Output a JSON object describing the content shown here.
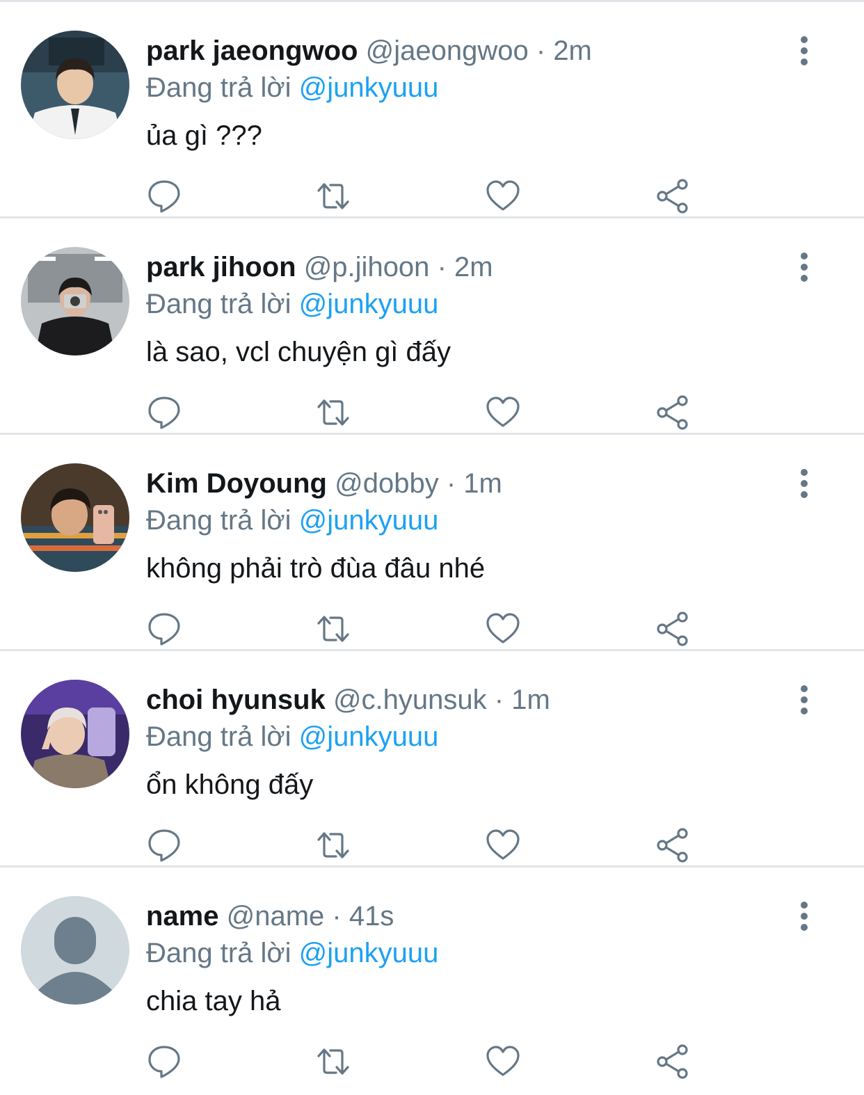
{
  "tweets": [
    {
      "display_name": "park jaeongwoo",
      "handle": "@jaeongwoo",
      "separator": "·",
      "time": "2m",
      "replying_prefix": "Đang trả lời",
      "replying_to": "@junkyuuu",
      "text": "ủa gì ???"
    },
    {
      "display_name": "park jihoon",
      "handle": "@p.jihoon",
      "separator": "·",
      "time": "2m",
      "replying_prefix": "Đang trả lời",
      "replying_to": "@junkyuuu",
      "text": "là sao, vcl chuyện gì đấy"
    },
    {
      "display_name": "Kim Doyoung",
      "handle": "@dobby",
      "separator": "·",
      "time": "1m",
      "replying_prefix": "Đang trả lời",
      "replying_to": "@junkyuuu",
      "text": "không phải trò đùa đâu nhé"
    },
    {
      "display_name": "choi hyunsuk",
      "handle": "@c.hyunsuk",
      "separator": "·",
      "time": "1m",
      "replying_prefix": "Đang trả lời",
      "replying_to": "@junkyuuu",
      "text": "ổn không đấy"
    },
    {
      "display_name": "name",
      "handle": "@name",
      "separator": "·",
      "time": "41s",
      "replying_prefix": "Đang trả lời",
      "replying_to": "@junkyuuu",
      "text": "chia tay hả"
    }
  ],
  "icons": {
    "reply": "reply-icon",
    "retweet": "retweet-icon",
    "like": "heart-icon",
    "share": "share-icon",
    "more": "more-vertical-icon"
  },
  "colors": {
    "text_primary": "#14171a",
    "text_secondary": "#657786",
    "link": "#1da1f2",
    "divider": "#e1e4e8",
    "icon": "#657786"
  }
}
